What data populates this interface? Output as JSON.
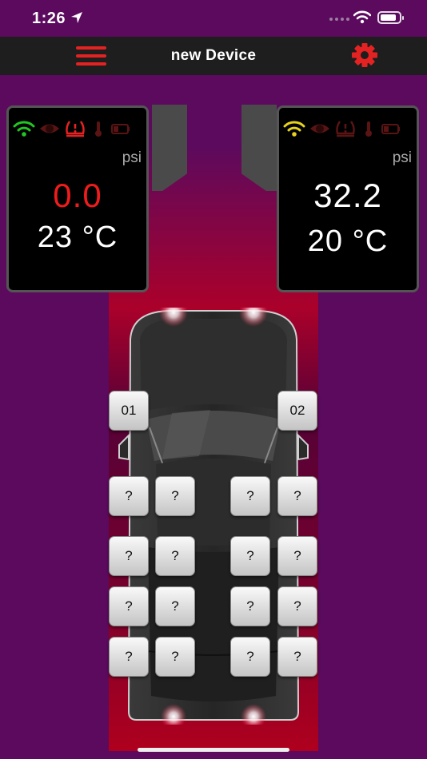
{
  "status_bar": {
    "time": "1:26"
  },
  "nav": {
    "title": "new Device"
  },
  "panels": {
    "left": {
      "unit": "psi",
      "pressure": "0.0",
      "temperature": "23 °C"
    },
    "right": {
      "unit": "psi",
      "pressure": "32.2",
      "temperature": "20 °C"
    }
  },
  "tires": {
    "front_left": "01",
    "front_right": "02",
    "slots": [
      "?",
      "?",
      "?",
      "?",
      "?",
      "?",
      "?",
      "?",
      "?",
      "?",
      "?",
      "?",
      "?",
      "?",
      "?",
      "?"
    ]
  },
  "icons": {
    "left_signal": "wifi-icon",
    "right_signal": "wifi-icon",
    "alert": "tire-pressure-warning-icon",
    "sensor": "eye-icon",
    "temperature": "thermometer-icon",
    "battery": "battery-icon"
  },
  "colors": {
    "background": "#5b0a5e",
    "accent": "#e52222",
    "alarm": "#ee1c1c",
    "signal_ok": "#22c522",
    "signal_warn": "#e6d21e"
  }
}
